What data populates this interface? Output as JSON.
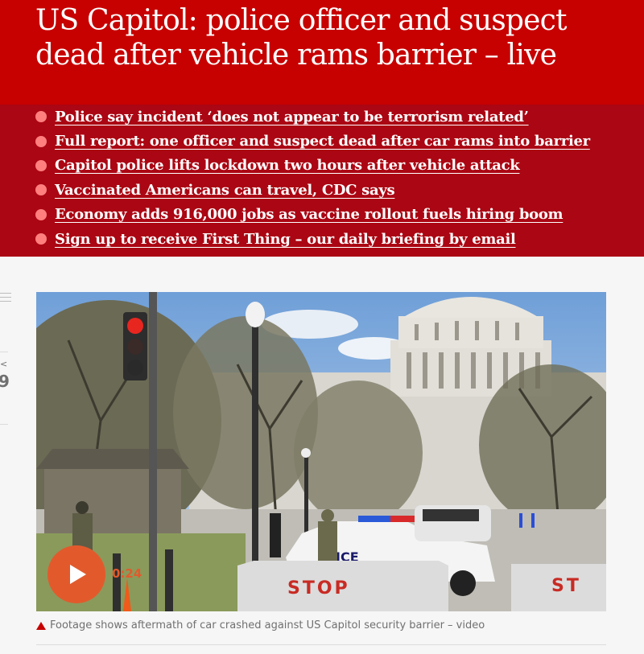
{
  "headline": "US Capitol: police officer and suspect dead after vehicle rams barrier – live",
  "bullets": [
    "Police say incident ‘does not appear to be terrorism related’",
    "Full report: one officer and suspect dead after car rams into barrier",
    "Capitol police lifts lockdown two hours after vehicle attack",
    "Vaccinated Americans can travel, CDC says",
    "Economy adds 916,000 jobs as vaccine rollout fuels hiring boom",
    "Sign up to receive First Thing – our daily briefing by email"
  ],
  "share": {
    "count": "9"
  },
  "video": {
    "duration": "0:24",
    "stop_sign_text": "STOP",
    "stop_sign_text_2": "ST",
    "car_badge_text": "ICE"
  },
  "caption": "Footage shows aftermath of car crashed against US Capitol security barrier – video",
  "colors": {
    "header": "#c70000",
    "bullet_band": "#ab0613",
    "bullet_dot": "#ff7f7f",
    "play": "#e25a2c"
  }
}
